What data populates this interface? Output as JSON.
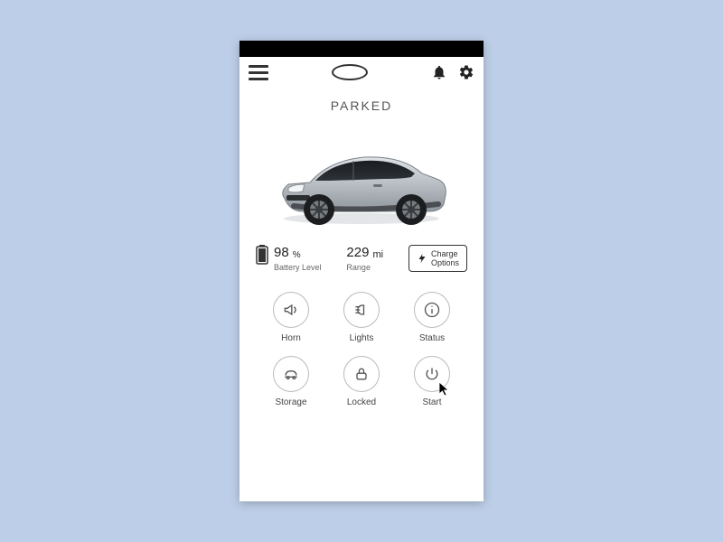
{
  "status": "PARKED",
  "battery": {
    "value": "98",
    "unit": "%",
    "label": "Battery Level"
  },
  "range": {
    "value": "229",
    "unit": "mi",
    "label": "Range"
  },
  "charge_button": "Charge\nOptions",
  "tiles": [
    {
      "label": "Horn"
    },
    {
      "label": "Lights"
    },
    {
      "label": "Status"
    },
    {
      "label": "Storage"
    },
    {
      "label": "Locked"
    },
    {
      "label": "Start"
    }
  ]
}
